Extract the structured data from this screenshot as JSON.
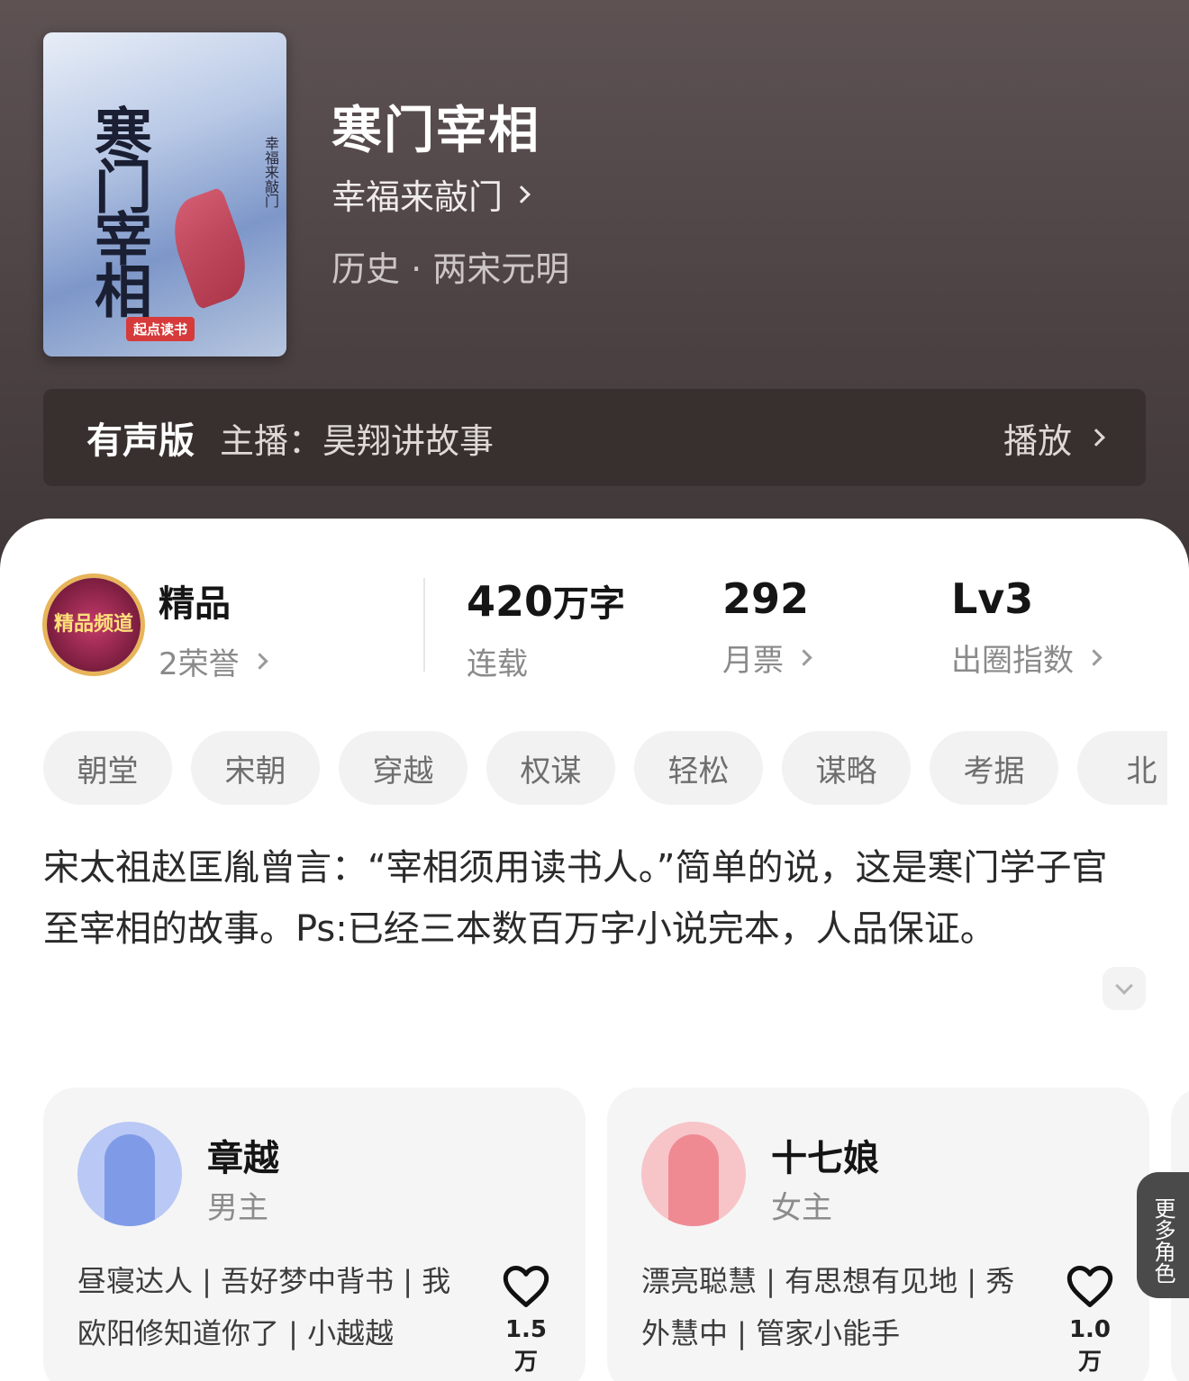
{
  "book": {
    "title": "寒门宰相",
    "author": "幸福来敲门",
    "genre": "历史 · 两宋元明"
  },
  "cover": {
    "title_text": "寒门宰相",
    "author_text": "幸福来敲门",
    "publisher": "起点读书"
  },
  "audio": {
    "label": "有声版",
    "host": "主播：昊翔讲故事",
    "play": "播放"
  },
  "stats": {
    "badge_text": "精品频道",
    "quality_label": "精品",
    "honors": "2荣誉",
    "words": "420",
    "words_unit": "万字",
    "status": "连载",
    "votes": "292",
    "votes_label": "月票",
    "level": "Lv3",
    "level_label": "出圈指数"
  },
  "tags": [
    "朝堂",
    "宋朝",
    "穿越",
    "权谋",
    "轻松",
    "谋略",
    "考据",
    "北"
  ],
  "description": "宋太祖赵匡胤曾言：“宰相须用读书人。”简单的说，这是寒门学子官至宰相的故事。Ps:已经三本数百万字小说完本，人品保证。",
  "roles": [
    {
      "name": "章越",
      "type": "男主",
      "traits": "昼寝达人 | 吾好梦中背书 | 我欧阳修知道你了 | 小越越",
      "likes": "1.5万",
      "color": "#7f9be8"
    },
    {
      "name": "十七娘",
      "type": "女主",
      "traits": "漂亮聪慧 | 有思想有见地 | 秀外慧中 | 管家小能手",
      "likes": "1.0万",
      "color": "#ef8a93"
    }
  ],
  "more_roles": "更多角色"
}
